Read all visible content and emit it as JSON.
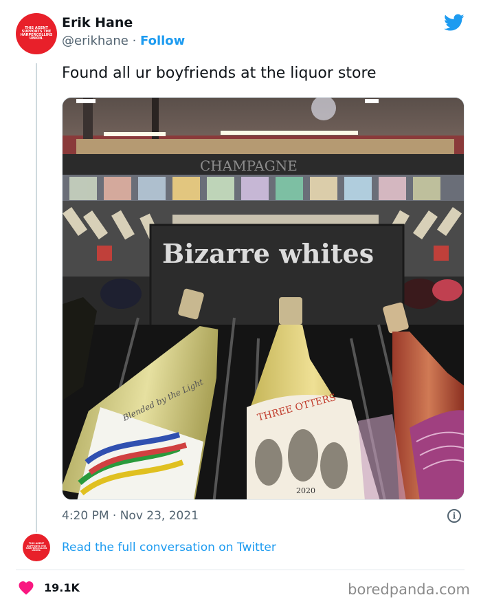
{
  "author": {
    "name": "Erik Hane",
    "handle": "@erikhane",
    "separator": "·",
    "follow_label": "Follow",
    "avatar_lettering": "THIS AGENT SUPPORTS THE HARPERCOLLINS UNION."
  },
  "tweet": {
    "text": "Found all ur boyfriends at the liquor store",
    "time": "4:20 PM",
    "date": "Nov 23, 2021"
  },
  "photo": {
    "store_sign": "CHAMPAGNE",
    "shelf_sign": "Bizarre whites",
    "label_left": "Blended by the Light",
    "label_center_brand": "THREE OTTERS",
    "label_center_year": "2020"
  },
  "conversation_link": "Read the full conversation on Twitter",
  "likes": "19.1K",
  "watermark": "boredpanda.com",
  "colors": {
    "accent": "#1d9bf0",
    "heart": "#f91880",
    "avatar_bg": "#e8202a"
  },
  "icons": [
    "twitter-bird-icon",
    "info-icon",
    "heart-icon"
  ]
}
